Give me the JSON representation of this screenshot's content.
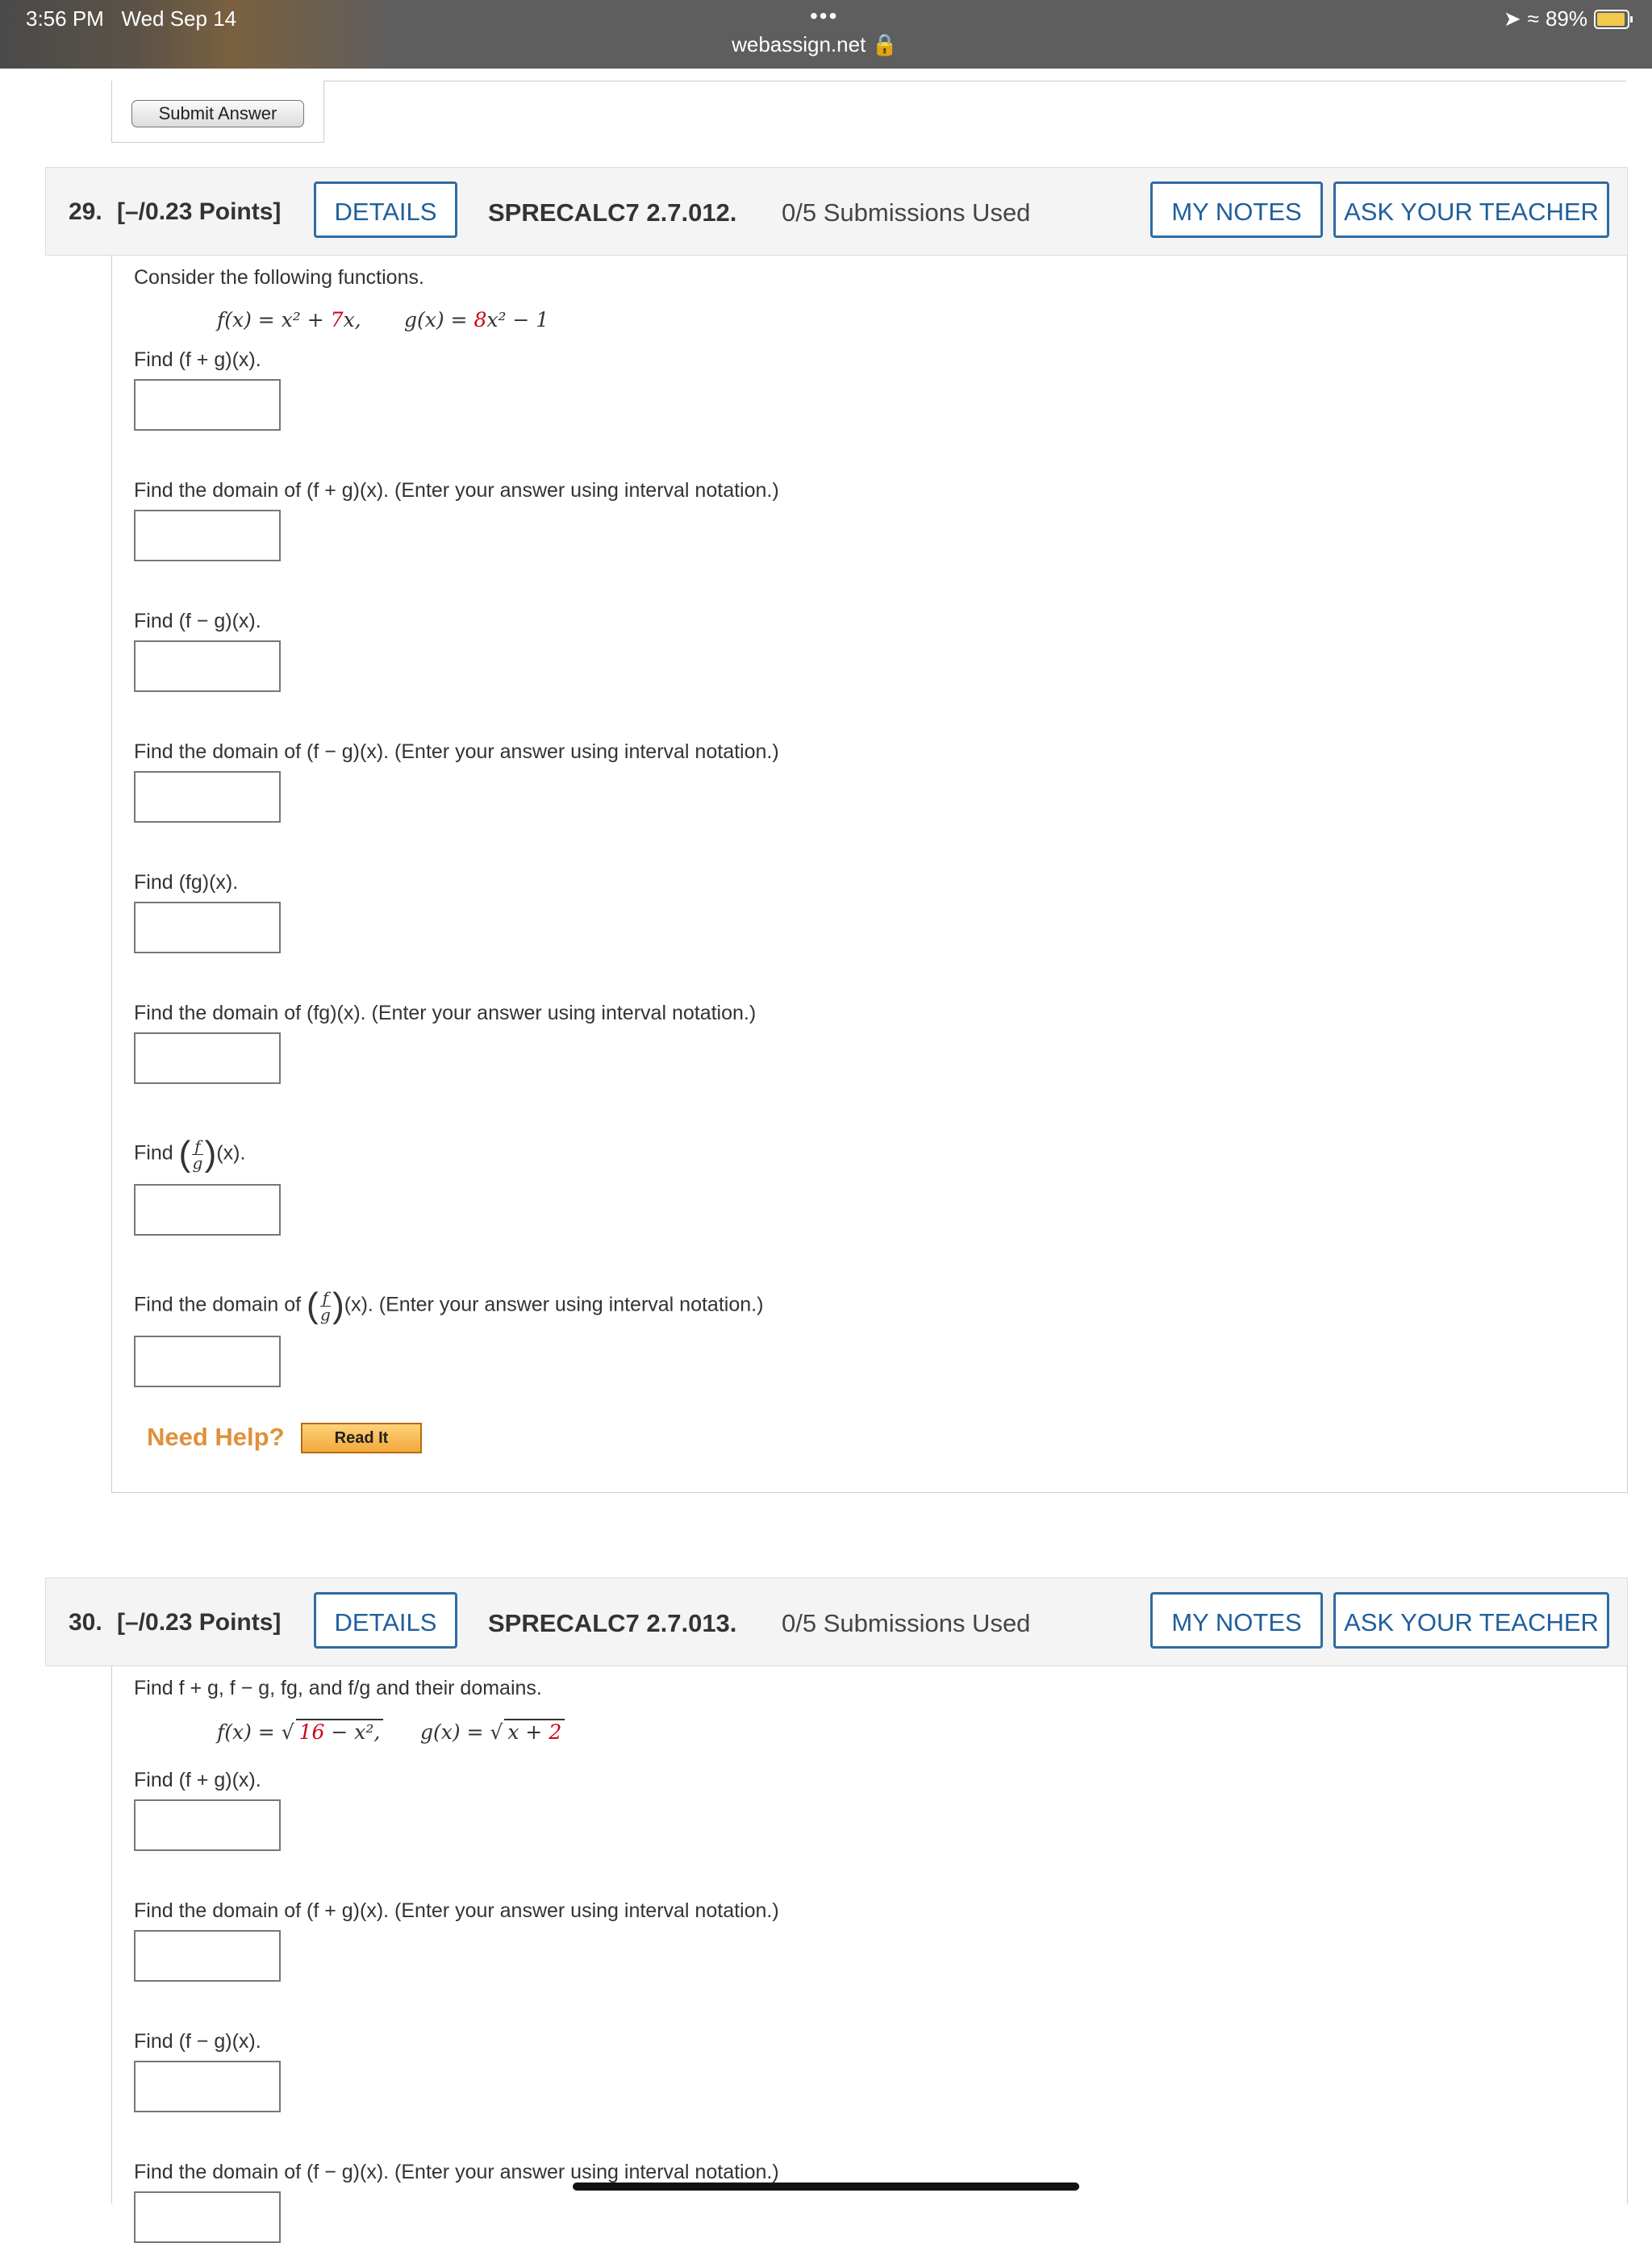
{
  "status_bar": {
    "time": "3:56 PM",
    "date": "Wed Sep 14",
    "url": "webassign.net",
    "battery": "89%",
    "battery_level": 0.89
  },
  "prev_submit_label": "Submit Answer",
  "questions": [
    {
      "number": "29.",
      "points": "[–/0.23 Points]",
      "details_label": "DETAILS",
      "code": "SPRECALC7 2.7.012.",
      "submissions": "0/5 Submissions Used",
      "notes_label": "MY NOTES",
      "ask_label": "ASK YOUR TEACHER",
      "intro": "Consider the following functions.",
      "f_def": "f(x) = x² + ",
      "f_red": "7",
      "f_end": "x,",
      "g_def": "g(x) = ",
      "g_red": "8",
      "g_end": "x² − 1",
      "prompts": {
        "p1": "Find  (f + g)(x).",
        "p2": "Find the domain of  (f + g)(x).  (Enter your answer using interval notation.)",
        "p3": "Find  (f − g)(x).",
        "p4": "Find the domain of  (f − g)(x).  (Enter your answer using interval notation.)",
        "p5": "Find  (fg)(x).",
        "p6": "Find the domain of  (fg)(x).  (Enter your answer using interval notation.)",
        "p7_pre": "Find",
        "p7_post": "(x).",
        "p8_pre": "Find the domain of",
        "p8_post": "(x).  (Enter your answer using interval notation.)",
        "frac_num": "f",
        "frac_den": "g"
      },
      "need_help": "Need Help?",
      "read_it": "Read It"
    },
    {
      "number": "30.",
      "points": "[–/0.23 Points]",
      "details_label": "DETAILS",
      "code": "SPRECALC7 2.7.013.",
      "submissions": "0/5 Submissions Used",
      "notes_label": "MY NOTES",
      "ask_label": "ASK YOUR TEACHER",
      "intro": "Find  f + g,   f − g,   fg,  and  f/g  and their domains.",
      "f_def": "f(x) = ",
      "f_red": "16",
      "f_end": " − x²,",
      "g_def": "g(x) = ",
      "g_in": "x + ",
      "g_red": "2",
      "prompts": {
        "p1": "Find  (f + g)(x).",
        "p2": "Find the domain of  (f + g)(x).  (Enter your answer using interval notation.)",
        "p3": "Find  (f − g)(x).",
        "p4": "Find the domain of  (f − g)(x).  (Enter your answer using interval notation.)"
      }
    }
  ]
}
